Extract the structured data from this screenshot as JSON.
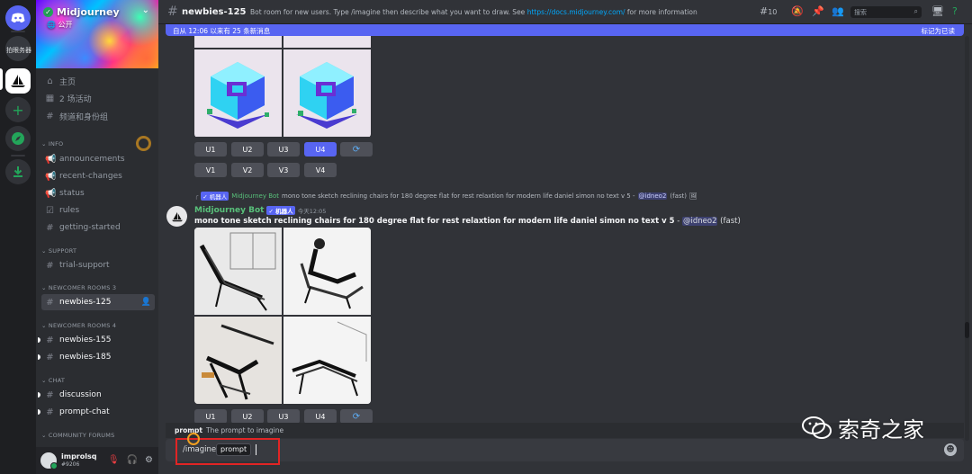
{
  "rail": {
    "server_label": "拍眼务器"
  },
  "sidebar": {
    "server_name": "Midjourney",
    "server_visibility": "公开",
    "top_items": [
      {
        "label": "主页",
        "icon": "home-icon"
      },
      {
        "label": "2 场活动",
        "icon": "calendar-icon"
      },
      {
        "label": "频道和身份组",
        "icon": "channels-icon"
      }
    ],
    "categories": {
      "info": "INFO",
      "support": "SUPPORT",
      "newcomer3": "NEWCOMER ROOMS 3",
      "newcomer4": "NEWCOMER ROOMS 4",
      "chat": "CHAT",
      "forums": "COMMUNITY FORUMS"
    },
    "info_channels": [
      "announcements",
      "recent-changes",
      "status",
      "rules",
      "getting-started"
    ],
    "support_channels": [
      "trial-support"
    ],
    "newcomer3_channels": [
      "newbies-125"
    ],
    "newcomer4_channels": [
      "newbies-155",
      "newbies-185"
    ],
    "chat_channels": [
      "discussion",
      "prompt-chat"
    ]
  },
  "user": {
    "name": "improlsq",
    "tag": "#9206"
  },
  "header": {
    "channel": "newbies-125",
    "topic_prefix": "Bot room for new users. Type /imagine then describe what you want to draw. See ",
    "topic_link": "https://docs.midjourney.com/",
    "topic_suffix": " for more information",
    "thread_count": "10",
    "search_placeholder": "搜索"
  },
  "new_messages_bar": {
    "text": "自从 12:06 以来有 25 条新消息",
    "mark_read": "标记为已读"
  },
  "buttons": {
    "upscale": [
      "U1",
      "U2",
      "U3",
      "U4"
    ],
    "variation": [
      "V1",
      "V2",
      "V3",
      "V4"
    ],
    "reroll": "⟳"
  },
  "message": {
    "reply_tag": "✓ 机器人",
    "reply_author": "Midjourney Bot",
    "reply_text": "mono tone sketch reclining chairs for 180 degree flat for rest relaxtion for modern life daniel simon no text v 5 - ",
    "reply_mention": "@idneo2",
    "reply_speed": "(fast)",
    "author": "Midjourney Bot",
    "bot_tag": "✓ 机器人",
    "timestamp": "今天12:05",
    "content": "mono tone sketch reclining chairs for 180 degree flat for rest relaxtion for modern life daniel simon no text v 5",
    "separator": " - ",
    "mention": "@idneo2",
    "speed": " (fast)"
  },
  "composer": {
    "hint_label": "prompt",
    "hint_text": "The prompt to imagine",
    "command": "/imagine",
    "option": "prompt"
  },
  "watermark": "索奇之家",
  "colors": {
    "blurple": "#5865f2",
    "bot_green": "#58c07a",
    "highlight_red": "#e12424"
  }
}
